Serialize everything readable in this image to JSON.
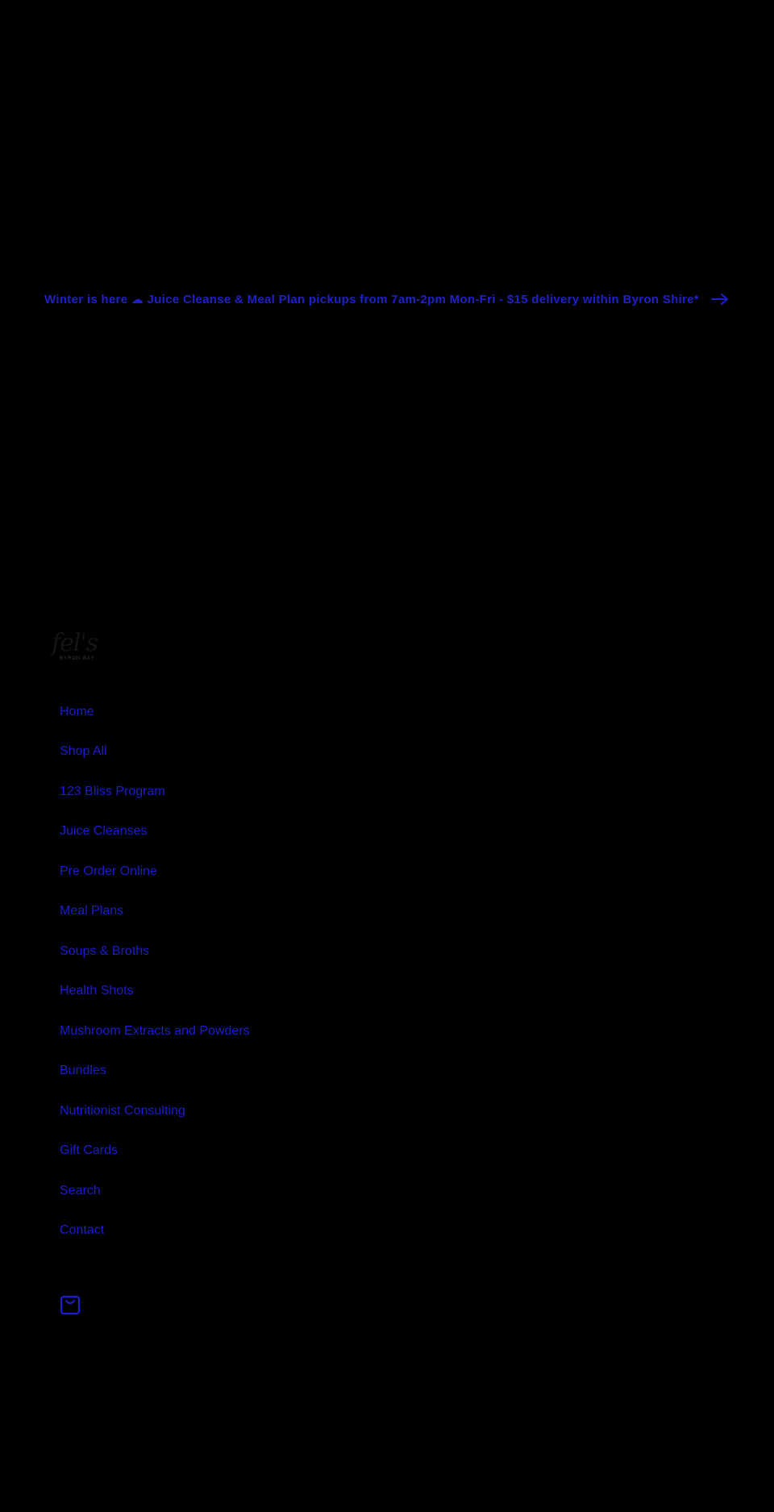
{
  "announcement": {
    "text": "Winter is here ☁ Juice Cleanse & Meal Plan pickups from 7am-2pm Mon-Fri - $15 delivery within Byron Shire*",
    "icon": "arrow-right-icon"
  },
  "logo": {
    "script": "fel's",
    "subtitle": "BYRON BAY"
  },
  "menu": {
    "items": [
      {
        "label": "Home"
      },
      {
        "label": "Shop All"
      },
      {
        "label": "123 Bliss Program"
      },
      {
        "label": "Juice Cleanses"
      },
      {
        "label": "Pre Order Online"
      },
      {
        "label": "Meal Plans"
      },
      {
        "label": "Soups & Broths"
      },
      {
        "label": "Health Shots"
      },
      {
        "label": "Mushroom Extracts and Powders"
      },
      {
        "label": "Bundles"
      },
      {
        "label": "Nutritionist Consulting"
      },
      {
        "label": "Gift Cards"
      },
      {
        "label": "Search"
      },
      {
        "label": "Contact"
      }
    ]
  },
  "cart": {
    "icon": "shopping-bag-icon"
  },
  "colors": {
    "background": "#000000",
    "link": "#1c1cd0",
    "logo": "#151515"
  }
}
